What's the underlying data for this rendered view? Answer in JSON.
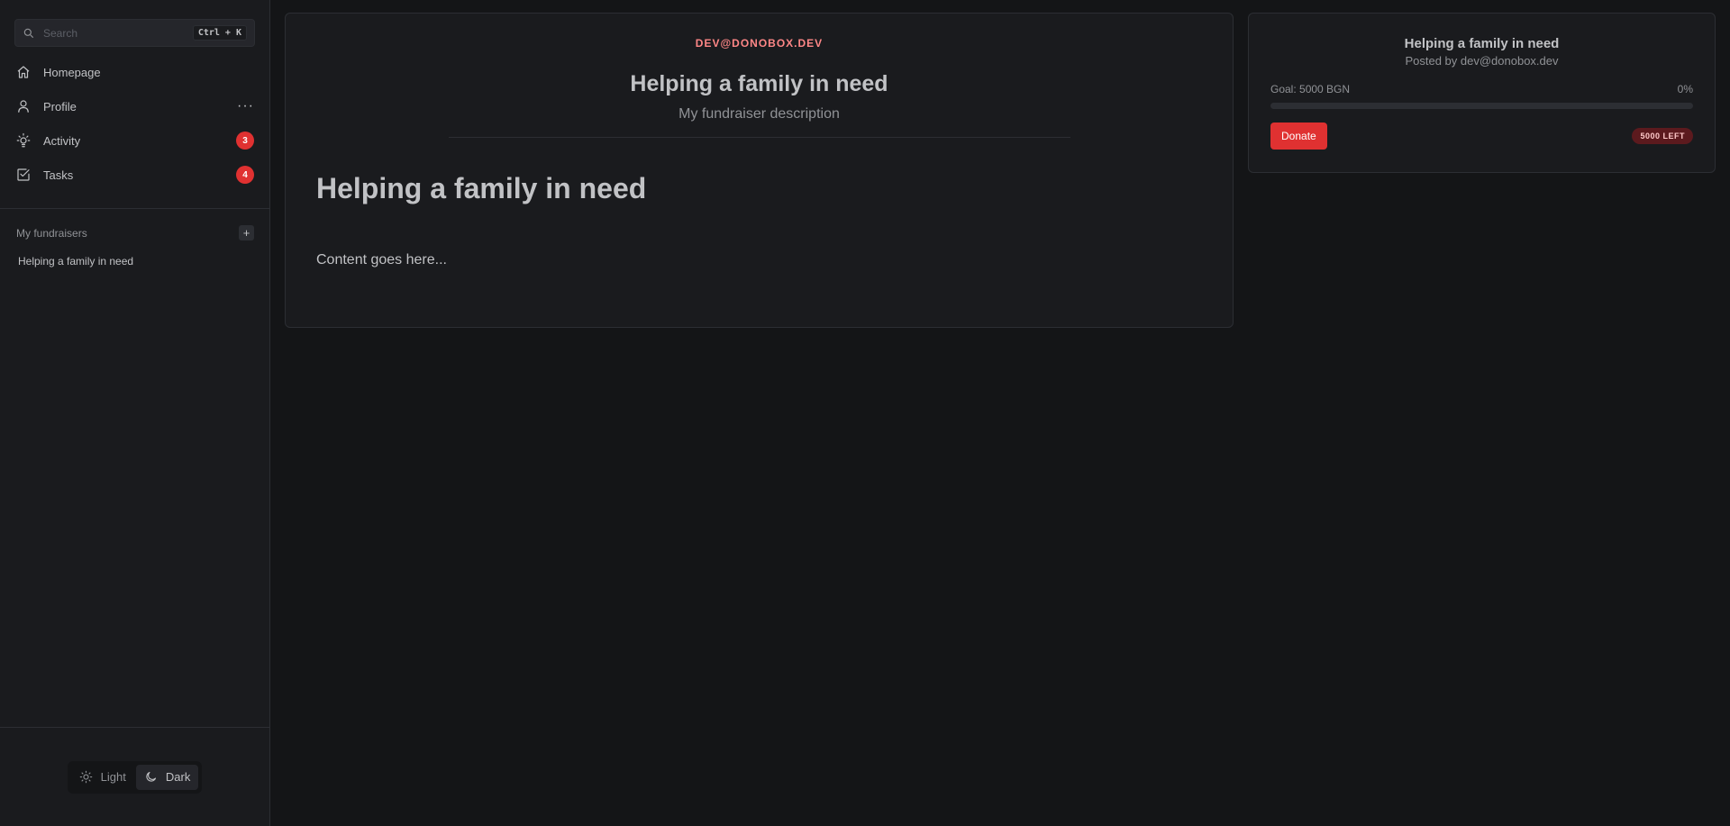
{
  "sidebar": {
    "search": {
      "placeholder": "Search",
      "shortcut": "Ctrl + K"
    },
    "nav": [
      {
        "label": "Homepage",
        "icon": "home-icon"
      },
      {
        "label": "Profile",
        "icon": "user-icon",
        "more": "···"
      },
      {
        "label": "Activity",
        "icon": "bulb-icon",
        "badge": "3"
      },
      {
        "label": "Tasks",
        "icon": "checkbox-icon",
        "badge": "4"
      }
    ],
    "section": {
      "title": "My fundraisers",
      "add_label": "+"
    },
    "fundraisers": [
      {
        "label": "Helping a family in need"
      }
    ],
    "theme": {
      "light_label": "Light",
      "dark_label": "Dark",
      "selected": "Dark"
    }
  },
  "main": {
    "author": "DEV@DONOBOX.DEV",
    "title": "Helping a family in need",
    "subtitle": "My fundraiser description",
    "content_heading": "Helping a family in need",
    "content_text": "Content goes here..."
  },
  "side_card": {
    "title": "Helping a family in need",
    "posted_by": "Posted by dev@donobox.dev",
    "goal": "Goal: 5000 BGN",
    "percent": "0%",
    "progress": 0,
    "donate_label": "Donate",
    "left_badge": "5000 LEFT"
  },
  "colors": {
    "accent": "#e03131",
    "author": "#ff8787",
    "background": "#141517",
    "surface": "#1a1b1e"
  }
}
